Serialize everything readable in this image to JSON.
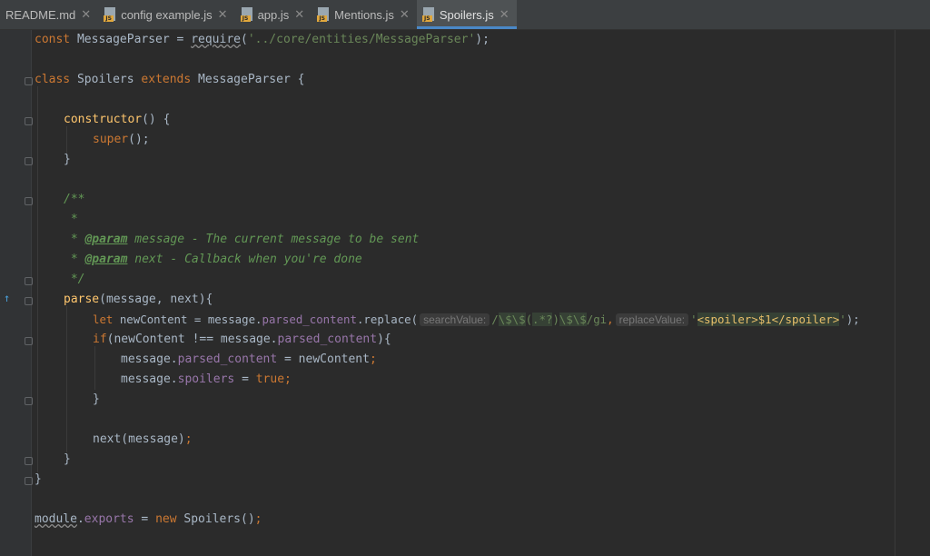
{
  "tabs": [
    {
      "label": "README.md",
      "icon": "markdown-file-icon",
      "active": false
    },
    {
      "label": "config example.js",
      "icon": "js-file-icon",
      "active": false
    },
    {
      "label": "app.js",
      "icon": "js-file-icon",
      "active": false
    },
    {
      "label": "Mentions.js",
      "icon": "js-file-icon",
      "active": false
    },
    {
      "label": "Spoilers.js",
      "icon": "js-file-icon",
      "active": true
    }
  ],
  "close_glyph": "✕",
  "code": {
    "l1_const": "const",
    "l1_name": " MessageParser = ",
    "l1_require": "require",
    "l1_paren_open": "(",
    "l1_path": "'../core/entities/MessageParser'",
    "l1_end": ");",
    "l3_class": "class",
    "l3_name": " Spoilers ",
    "l3_extends": "extends",
    "l3_base": " MessageParser {",
    "l5_ctor": "constructor",
    "l5_rest": "() {",
    "l6_super": "super",
    "l6_rest": "();",
    "l7_close": "}",
    "l9_c": "/**",
    "l10_c": " *",
    "l11_star": " * ",
    "l11_tag": "@param",
    "l11_text": " message - The current message to be sent",
    "l12_star": " * ",
    "l12_tag": "@param",
    "l12_text": " next - Callback when you're done",
    "l13_c": " */",
    "l14_fn": "parse",
    "l14_rest": "(message, next){",
    "l15_let": "let",
    "l15_a": " newContent = message.",
    "l15_prop": "parsed_content",
    "l15_dot": ".",
    "l15_replace": "replace",
    "l15_paren": "(",
    "l15_hint1": "searchValue:",
    "l15_rx1": "/",
    "l15_rx2": "\\$\\$",
    "l15_rx3": "(",
    "l15_rx4": ".*?",
    "l15_rx5": ")",
    "l15_rx6": "\\$\\$",
    "l15_rx7": "/gi",
    "l15_comma": ",",
    "l15_hint2": "replaceValue:",
    "l15_q1": "'",
    "l15_inj": "<spoiler>$1</spoiler>",
    "l15_q2": "'",
    "l15_end": ");",
    "l16_if": "if",
    "l16_a": "(newContent !== message.",
    "l16_prop": "parsed_content",
    "l16_end": "){",
    "l17_a": "message.",
    "l17_prop": "parsed_content",
    "l17_b": " = newContent",
    "l17_semi": ";",
    "l18_a": "message.",
    "l18_prop": "spoilers",
    "l18_b": " = ",
    "l18_true": "true",
    "l18_semi": ";",
    "l19_close": "}",
    "l21_next": "next(message)",
    "l21_semi": ";",
    "l22_close": "}",
    "l23_close": "}",
    "l25_module": "module",
    "l25_dot": ".",
    "l25_exports": "exports",
    "l25_eq": " = ",
    "l25_new": "new",
    "l25_rest": " Spoilers()",
    "l25_semi": ";"
  },
  "gutter": {
    "override_marker_icon": "override-marker-icon",
    "override_glyph": "↑"
  },
  "colors": {
    "background": "#2b2b2b",
    "keyword": "#cc7832",
    "string": "#6a8759",
    "function": "#ffc66d",
    "property": "#9876aa",
    "accent": "#4a88c7"
  }
}
